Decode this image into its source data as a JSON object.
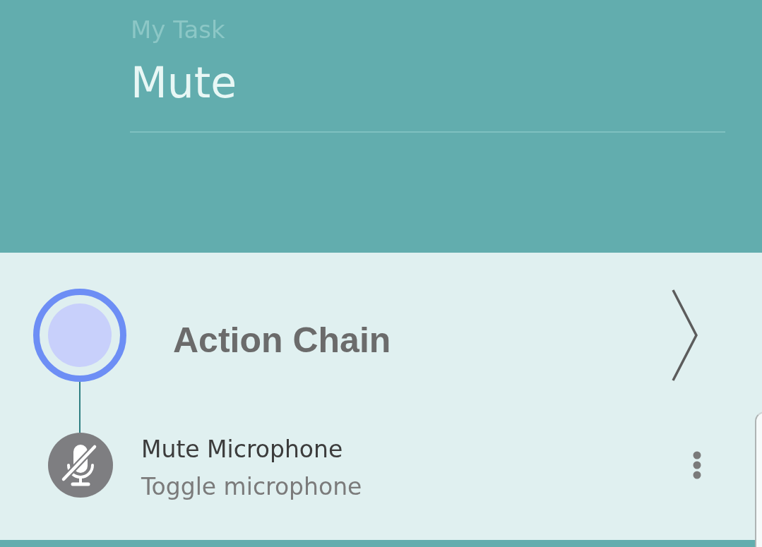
{
  "task": {
    "label": "My Task",
    "value": "Mute"
  },
  "action_chain": {
    "title": "Action Chain",
    "actions": [
      {
        "title": "Mute Microphone",
        "subtitle": "Toggle microphone"
      }
    ]
  }
}
